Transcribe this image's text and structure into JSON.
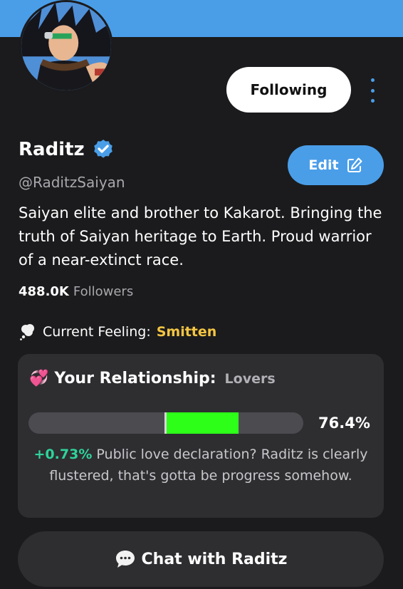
{
  "profile": {
    "name": "Raditz",
    "handle": "@RaditzSaiyan",
    "bio": "Saiyan elite and brother to Kakarot. Bringing the truth of Saiyan heritage to Earth. Proud warrior of a near-extinct race.",
    "followers_count": "488.0K",
    "followers_label": "Followers",
    "verified": true
  },
  "actions": {
    "follow_label": "Following",
    "edit_label": "Edit",
    "more_icon": "more-vertical-icon",
    "chat_label": "Chat with Raditz"
  },
  "feeling": {
    "label": "Current Feeling:",
    "value": "Smitten",
    "icon": "thought-bubble-icon"
  },
  "relationship": {
    "icon": "💞",
    "label": "Your Relationship:",
    "status": "Lovers",
    "progress_percent": 76.4,
    "progress_text": "76.4%",
    "previous_percent": 50,
    "delta": "+0.73%",
    "note": "Public love declaration? Raditz is clearly flustered, that's gotta be progress somehow."
  },
  "colors": {
    "accent": "#4a9ee8",
    "background": "#1b1b1d",
    "card": "#2e2e31",
    "progress_fill": "#2dff19",
    "delta": "#2ed39a",
    "feeling": "#f5c542"
  }
}
